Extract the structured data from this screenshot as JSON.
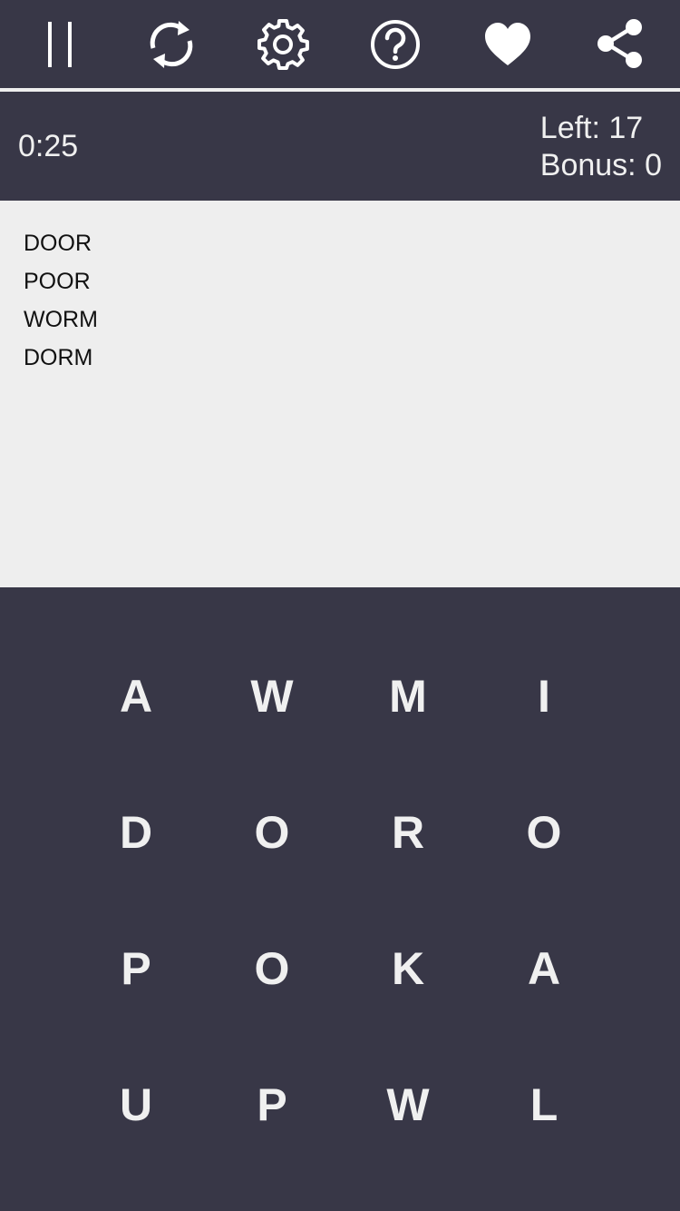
{
  "toolbar": {
    "buttons": [
      {
        "icon": "pause-icon"
      },
      {
        "icon": "restart-icon"
      },
      {
        "icon": "gear-icon"
      },
      {
        "icon": "help-icon"
      },
      {
        "icon": "heart-icon"
      },
      {
        "icon": "share-icon"
      }
    ],
    "icon_color": "#ffffff"
  },
  "status": {
    "timer": "0:25",
    "left": "Left: 17",
    "bonus": "Bonus: 0"
  },
  "found_words": [
    "DOOR",
    "POOR",
    "WORM",
    "DORM"
  ],
  "board": {
    "rows": [
      [
        "A",
        "W",
        "M",
        "I"
      ],
      [
        "D",
        "O",
        "R",
        "O"
      ],
      [
        "P",
        "O",
        "K",
        "A"
      ],
      [
        "U",
        "P",
        "W",
        "L"
      ]
    ]
  },
  "colors": {
    "background": "#383747",
    "panel": "#eeeeee",
    "text_light": "#f0f0f0",
    "text_dark": "#111111"
  }
}
